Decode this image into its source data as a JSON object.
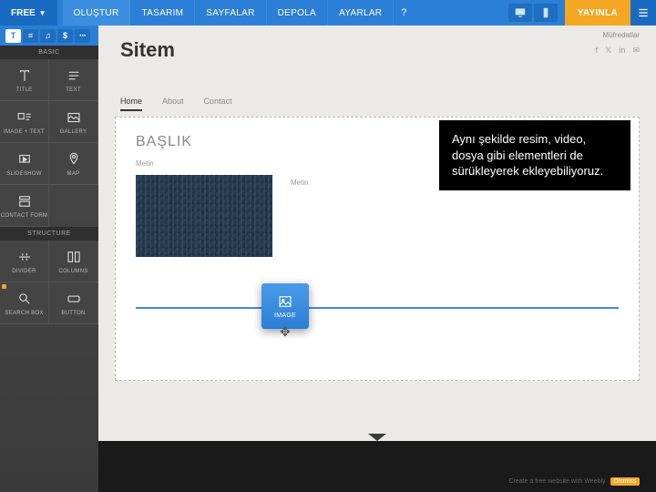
{
  "topbar": {
    "free_label": "FREE",
    "tabs": [
      "OLUŞTUR",
      "TASARIM",
      "SAYFALAR",
      "DEPOLA",
      "AYARLAR"
    ],
    "help": "?",
    "publish": "YAYINLA"
  },
  "tool_row": [
    "T",
    "≡",
    "♫",
    "$",
    "···"
  ],
  "sections": {
    "basic": "BASIC",
    "structure": "STRUCTURE"
  },
  "elements": {
    "title": "TITLE",
    "text": "TEXT",
    "image_text": "IMAGE + TEXT",
    "gallery": "GALLERY",
    "slideshow": "SLIDESHOW",
    "map": "MAP",
    "contact_form": "CONTACT FORM",
    "divider": "DIVIDER",
    "columns": "COLUMNS",
    "search_box": "SEARCH BOX",
    "button": "BUTTON"
  },
  "canvas": {
    "user_link": "Müfredatlar",
    "site_title": "Sitem",
    "page_tabs": [
      "Home",
      "About",
      "Contact"
    ],
    "heading": "BAŞLIK",
    "sub": "Metin",
    "text_label": "Metin"
  },
  "drag": {
    "label": "IMAGE"
  },
  "annotation": {
    "text": "Aynı şekilde resim, video, dosya gibi elementleri de sürükleyerek ekleyebiliyoruz."
  },
  "footer": {
    "credit_prefix": "Create a free website with Weebly",
    "badge": "Dismiss"
  }
}
